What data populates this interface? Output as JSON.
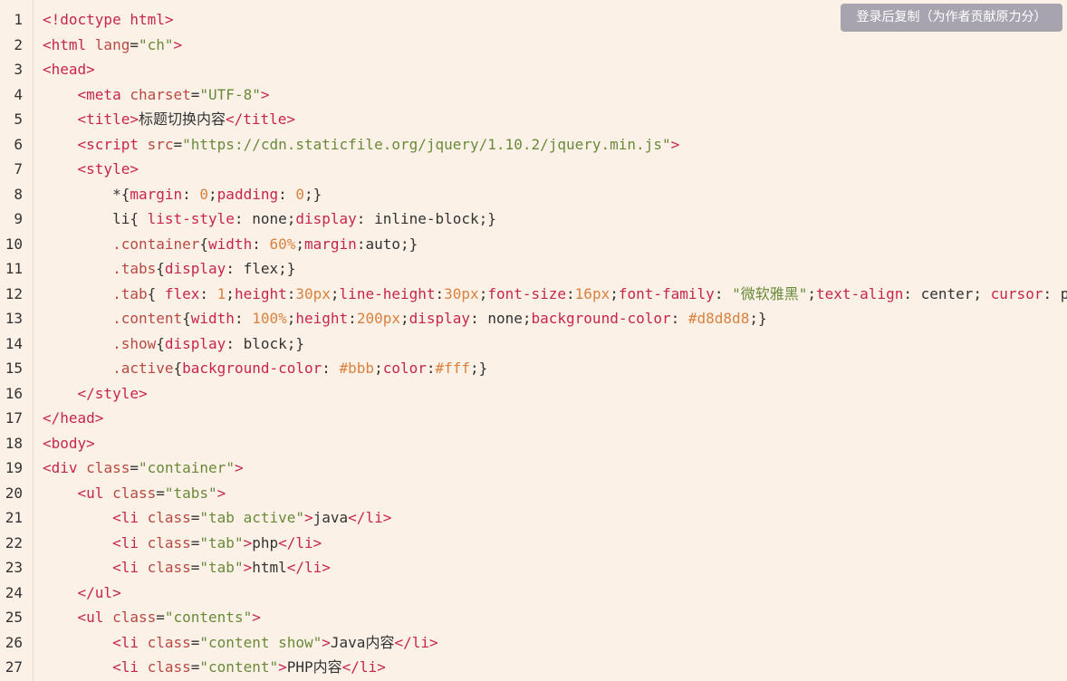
{
  "copy_button": "登录后复制（为作者贡献原力分）",
  "lines": [
    {
      "n": "1",
      "segs": [
        [
          "tg",
          "<!doctype html>"
        ]
      ]
    },
    {
      "n": "2",
      "segs": [
        [
          "tg",
          "<html "
        ],
        [
          "at",
          "lang"
        ],
        [
          "tx",
          "="
        ],
        [
          "st",
          "\"ch\""
        ],
        [
          "tg",
          ">"
        ]
      ]
    },
    {
      "n": "3",
      "segs": [
        [
          "tg",
          "<head>"
        ]
      ]
    },
    {
      "n": "4",
      "segs": [
        [
          "tx",
          "    "
        ],
        [
          "tg",
          "<meta "
        ],
        [
          "at",
          "charset"
        ],
        [
          "tx",
          "="
        ],
        [
          "st",
          "\"UTF-8\""
        ],
        [
          "tg",
          ">"
        ]
      ]
    },
    {
      "n": "5",
      "segs": [
        [
          "tx",
          "    "
        ],
        [
          "tg",
          "<title>"
        ],
        [
          "tx",
          "标题切换内容"
        ],
        [
          "tg",
          "</title>"
        ]
      ]
    },
    {
      "n": "6",
      "segs": [
        [
          "tx",
          "    "
        ],
        [
          "tg",
          "<script "
        ],
        [
          "at",
          "src"
        ],
        [
          "tx",
          "="
        ],
        [
          "st",
          "\"https://cdn.staticfile.org/jquery/1.10.2/jquery.min.js\""
        ],
        [
          "tg",
          ">"
        ]
      ]
    },
    {
      "n": "7",
      "segs": [
        [
          "tx",
          "    "
        ],
        [
          "tg",
          "<style>"
        ]
      ]
    },
    {
      "n": "8",
      "segs": [
        [
          "tx",
          "        *{"
        ],
        [
          "pr",
          "margin"
        ],
        [
          "tx",
          ": "
        ],
        [
          "nm",
          "0"
        ],
        [
          "tx",
          ";"
        ],
        [
          "pr",
          "padding"
        ],
        [
          "tx",
          ": "
        ],
        [
          "nm",
          "0"
        ],
        [
          "tx",
          ";}"
        ]
      ]
    },
    {
      "n": "9",
      "segs": [
        [
          "tx",
          "        li{ "
        ],
        [
          "pr",
          "list-style"
        ],
        [
          "tx",
          ": none;"
        ],
        [
          "pr",
          "display"
        ],
        [
          "tx",
          ": inline-block;}"
        ]
      ]
    },
    {
      "n": "10",
      "segs": [
        [
          "tx",
          "        "
        ],
        [
          "sel",
          ".container"
        ],
        [
          "tx",
          "{"
        ],
        [
          "pr",
          "width"
        ],
        [
          "tx",
          ": "
        ],
        [
          "nm",
          "60%"
        ],
        [
          "tx",
          ";"
        ],
        [
          "pr",
          "margin"
        ],
        [
          "tx",
          ":auto;}"
        ]
      ]
    },
    {
      "n": "11",
      "segs": [
        [
          "tx",
          "        "
        ],
        [
          "sel",
          ".tabs"
        ],
        [
          "tx",
          "{"
        ],
        [
          "pr",
          "display"
        ],
        [
          "tx",
          ": flex;}"
        ]
      ]
    },
    {
      "n": "12",
      "segs": [
        [
          "tx",
          "        "
        ],
        [
          "sel",
          ".tab"
        ],
        [
          "tx",
          "{ "
        ],
        [
          "pr",
          "flex"
        ],
        [
          "tx",
          ": "
        ],
        [
          "nm",
          "1"
        ],
        [
          "tx",
          ";"
        ],
        [
          "pr",
          "height"
        ],
        [
          "tx",
          ":"
        ],
        [
          "nm",
          "30px"
        ],
        [
          "tx",
          ";"
        ],
        [
          "pr",
          "line-height"
        ],
        [
          "tx",
          ":"
        ],
        [
          "nm",
          "30px"
        ],
        [
          "tx",
          ";"
        ],
        [
          "pr",
          "font-size"
        ],
        [
          "tx",
          ":"
        ],
        [
          "nm",
          "16px"
        ],
        [
          "tx",
          ";"
        ],
        [
          "pr",
          "font-family"
        ],
        [
          "tx",
          ": "
        ],
        [
          "st",
          "\"微软雅黑\""
        ],
        [
          "tx",
          ";"
        ],
        [
          "pr",
          "text-align"
        ],
        [
          "tx",
          ": center; "
        ],
        [
          "pr",
          "cursor"
        ],
        [
          "tx",
          ": p"
        ]
      ]
    },
    {
      "n": "13",
      "segs": [
        [
          "tx",
          "        "
        ],
        [
          "sel",
          ".content"
        ],
        [
          "tx",
          "{"
        ],
        [
          "pr",
          "width"
        ],
        [
          "tx",
          ": "
        ],
        [
          "nm",
          "100%"
        ],
        [
          "tx",
          ";"
        ],
        [
          "pr",
          "height"
        ],
        [
          "tx",
          ":"
        ],
        [
          "nm",
          "200px"
        ],
        [
          "tx",
          ";"
        ],
        [
          "pr",
          "display"
        ],
        [
          "tx",
          ": none;"
        ],
        [
          "pr",
          "background-color"
        ],
        [
          "tx",
          ": "
        ],
        [
          "nm",
          "#d8d8d8"
        ],
        [
          "tx",
          ";}"
        ]
      ]
    },
    {
      "n": "14",
      "segs": [
        [
          "tx",
          "        "
        ],
        [
          "sel",
          ".show"
        ],
        [
          "tx",
          "{"
        ],
        [
          "pr",
          "display"
        ],
        [
          "tx",
          ": block;}"
        ]
      ]
    },
    {
      "n": "15",
      "segs": [
        [
          "tx",
          "        "
        ],
        [
          "sel",
          ".active"
        ],
        [
          "tx",
          "{"
        ],
        [
          "pr",
          "background-color"
        ],
        [
          "tx",
          ": "
        ],
        [
          "nm",
          "#bbb"
        ],
        [
          "tx",
          ";"
        ],
        [
          "pr",
          "color"
        ],
        [
          "tx",
          ":"
        ],
        [
          "nm",
          "#fff"
        ],
        [
          "tx",
          ";}"
        ]
      ]
    },
    {
      "n": "16",
      "segs": [
        [
          "tx",
          "    "
        ],
        [
          "tg",
          "</style>"
        ]
      ]
    },
    {
      "n": "17",
      "segs": [
        [
          "tg",
          "</head>"
        ]
      ]
    },
    {
      "n": "18",
      "segs": [
        [
          "tg",
          "<body>"
        ]
      ]
    },
    {
      "n": "19",
      "segs": [
        [
          "tg",
          "<div "
        ],
        [
          "at",
          "class"
        ],
        [
          "tx",
          "="
        ],
        [
          "st",
          "\"container\""
        ],
        [
          "tg",
          ">"
        ]
      ]
    },
    {
      "n": "20",
      "segs": [
        [
          "tx",
          "    "
        ],
        [
          "tg",
          "<ul "
        ],
        [
          "at",
          "class"
        ],
        [
          "tx",
          "="
        ],
        [
          "st",
          "\"tabs\""
        ],
        [
          "tg",
          ">"
        ]
      ]
    },
    {
      "n": "21",
      "segs": [
        [
          "tx",
          "        "
        ],
        [
          "tg",
          "<li "
        ],
        [
          "at",
          "class"
        ],
        [
          "tx",
          "="
        ],
        [
          "st",
          "\"tab active\""
        ],
        [
          "tg",
          ">"
        ],
        [
          "tx",
          "java"
        ],
        [
          "tg",
          "</li>"
        ]
      ]
    },
    {
      "n": "22",
      "segs": [
        [
          "tx",
          "        "
        ],
        [
          "tg",
          "<li "
        ],
        [
          "at",
          "class"
        ],
        [
          "tx",
          "="
        ],
        [
          "st",
          "\"tab\""
        ],
        [
          "tg",
          ">"
        ],
        [
          "tx",
          "php"
        ],
        [
          "tg",
          "</li>"
        ]
      ]
    },
    {
      "n": "23",
      "segs": [
        [
          "tx",
          "        "
        ],
        [
          "tg",
          "<li "
        ],
        [
          "at",
          "class"
        ],
        [
          "tx",
          "="
        ],
        [
          "st",
          "\"tab\""
        ],
        [
          "tg",
          ">"
        ],
        [
          "tx",
          "html"
        ],
        [
          "tg",
          "</li>"
        ]
      ]
    },
    {
      "n": "24",
      "segs": [
        [
          "tx",
          "    "
        ],
        [
          "tg",
          "</ul>"
        ]
      ]
    },
    {
      "n": "25",
      "segs": [
        [
          "tx",
          "    "
        ],
        [
          "tg",
          "<ul "
        ],
        [
          "at",
          "class"
        ],
        [
          "tx",
          "="
        ],
        [
          "st",
          "\"contents\""
        ],
        [
          "tg",
          ">"
        ]
      ]
    },
    {
      "n": "26",
      "segs": [
        [
          "tx",
          "        "
        ],
        [
          "tg",
          "<li "
        ],
        [
          "at",
          "class"
        ],
        [
          "tx",
          "="
        ],
        [
          "st",
          "\"content show\""
        ],
        [
          "tg",
          ">"
        ],
        [
          "tx",
          "Java内容"
        ],
        [
          "tg",
          "</li>"
        ]
      ]
    },
    {
      "n": "27",
      "segs": [
        [
          "tx",
          "        "
        ],
        [
          "tg",
          "<li "
        ],
        [
          "at",
          "class"
        ],
        [
          "tx",
          "="
        ],
        [
          "st",
          "\"content\""
        ],
        [
          "tg",
          ">"
        ],
        [
          "tx",
          "PHP内容"
        ],
        [
          "tg",
          "</li>"
        ]
      ]
    }
  ]
}
